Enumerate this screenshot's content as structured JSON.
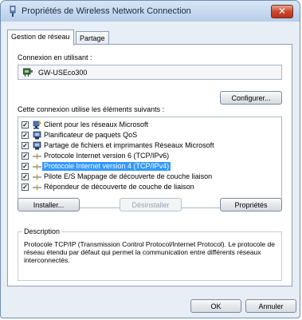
{
  "window": {
    "title": "Propriétés de Wireless Network Connection",
    "close_label": "✕"
  },
  "tabs": [
    {
      "label": "Gestion de réseau"
    },
    {
      "label": "Partage"
    }
  ],
  "connection": {
    "label": "Connexion en utilisant :",
    "adapter": "GW-USEco300",
    "configure_button": "Configurer..."
  },
  "components": {
    "label": "Cette connexion utilise les éléments suivants :",
    "items": [
      {
        "label": "Client pour les réseaux Microsoft",
        "icon": "network-client-icon",
        "checked": true
      },
      {
        "label": "Planificateur de paquets QoS",
        "icon": "service-icon",
        "checked": true
      },
      {
        "label": "Partage de fichiers et imprimantes Réseaux Microsoft",
        "icon": "service-icon",
        "checked": true
      },
      {
        "label": "Protocole Internet version 6 (TCP/IPv6)",
        "icon": "protocol-icon",
        "checked": true
      },
      {
        "label": "Protocole Internet version 4 (TCP/IPv4)",
        "icon": "protocol-icon",
        "checked": true,
        "selected": true
      },
      {
        "label": "Pilote E/S Mappage de découverte de couche liaison",
        "icon": "protocol-icon",
        "checked": true
      },
      {
        "label": "Répondeur de découverte de couche de liaison",
        "icon": "protocol-icon",
        "checked": true
      }
    ]
  },
  "buttons": {
    "install": "Installer...",
    "uninstall": "Désinstaller",
    "properties": "Propriétés",
    "ok": "OK",
    "cancel": "Annuler"
  },
  "description": {
    "title": "Description",
    "text": "Protocole TCP/IP (Transmission Control Protocol/Internet Protocol). Le protocole de réseau étendu par défaut qui permet la communication entre différents réseaux interconnectés."
  },
  "colors": {
    "selection": "#3399ff",
    "close_button": "#c9482d"
  }
}
